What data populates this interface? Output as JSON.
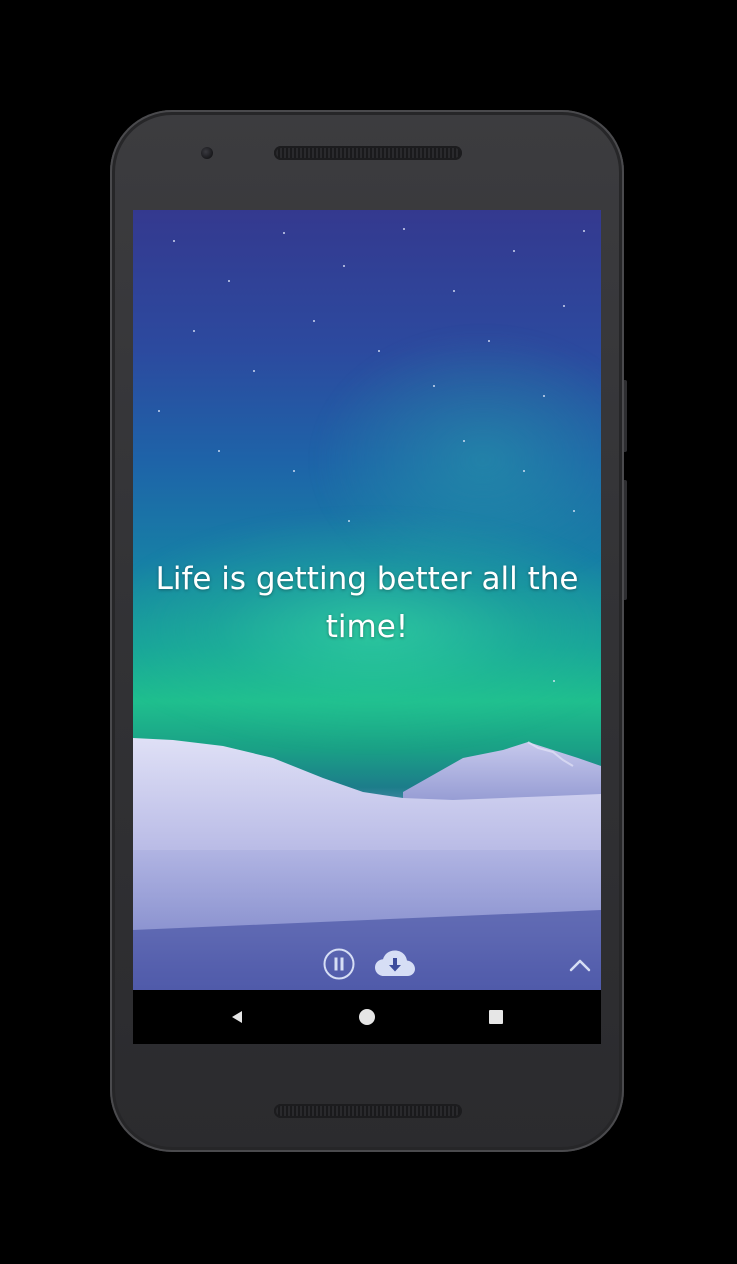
{
  "screen": {
    "quote_text": "Life is getting better all the time!",
    "background_theme": "aurora-over-snowy-mountains"
  },
  "controls": {
    "pause_icon": "pause-circle-icon",
    "download_icon": "cloud-download-icon",
    "expand_icon": "chevron-up-icon"
  },
  "navigation_bar": {
    "back_icon": "back-triangle-icon",
    "home_icon": "home-circle-icon",
    "recents_icon": "recents-square-icon"
  },
  "colors": {
    "quote_text": "#ffffff",
    "control_icon": "#d6def5",
    "nav_icon": "#e6e6e6",
    "device_body": "#353538"
  }
}
